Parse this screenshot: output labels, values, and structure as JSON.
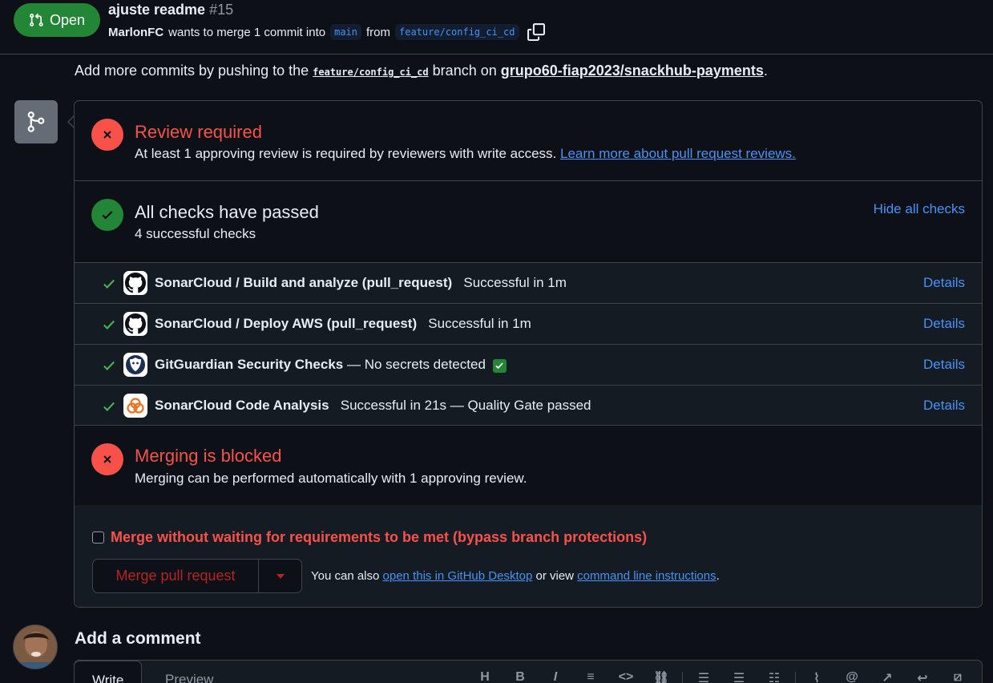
{
  "header": {
    "status_label": "Open",
    "title": "ajuste readme",
    "number": "#15",
    "author": "MarlonFC",
    "merge_text": "wants to merge 1 commit into",
    "base_branch": "main",
    "from_text": "from",
    "head_branch": "feature/config_ci_cd"
  },
  "push_note": {
    "prefix": "Add more commits by pushing to the",
    "branch": "feature/config_ci_cd",
    "middle": "branch on",
    "repo": "grupo60-fiap2023/snackhub-payments",
    "suffix": "."
  },
  "review": {
    "title": "Review required",
    "description": "At least 1 approving review is required by reviewers with write access.",
    "link": "Learn more about pull request reviews."
  },
  "checks": {
    "title": "All checks have passed",
    "subtitle": "4 successful checks",
    "toggle_label": "Hide all checks",
    "items": [
      {
        "name": "SonarCloud / Build and analyze (pull_request)",
        "status": "Successful in 1m",
        "details": "Details",
        "logo": "github-icon"
      },
      {
        "name": "SonarCloud / Deploy AWS (pull_request)",
        "status": "Successful in 1m",
        "details": "Details",
        "logo": "github-icon"
      },
      {
        "name": "GitGuardian Security Checks",
        "status": "— No secrets detected",
        "details": "Details",
        "logo": "gitguardian-icon"
      },
      {
        "name": "SonarCloud Code Analysis",
        "status": "Successful in 21s — Quality Gate passed",
        "details": "Details",
        "logo": "sonarcloud-icon"
      }
    ]
  },
  "blocked": {
    "title": "Merging is blocked",
    "description": "Merging can be performed automatically with 1 approving review."
  },
  "merge": {
    "bypass_label": "Merge without waiting for requirements to be met (bypass branch protections)",
    "button_label": "Merge pull request",
    "help_prefix": "You can also",
    "desktop_link": "open this in GitHub Desktop",
    "help_middle": "or view",
    "cli_link": "command line instructions",
    "help_suffix": "."
  },
  "comment": {
    "heading": "Add a comment",
    "tab_write": "Write",
    "tab_preview": "Preview"
  },
  "colors": {
    "success": "#238636",
    "danger": "#f85149",
    "link": "#4493f8",
    "background": "#0d1117"
  }
}
